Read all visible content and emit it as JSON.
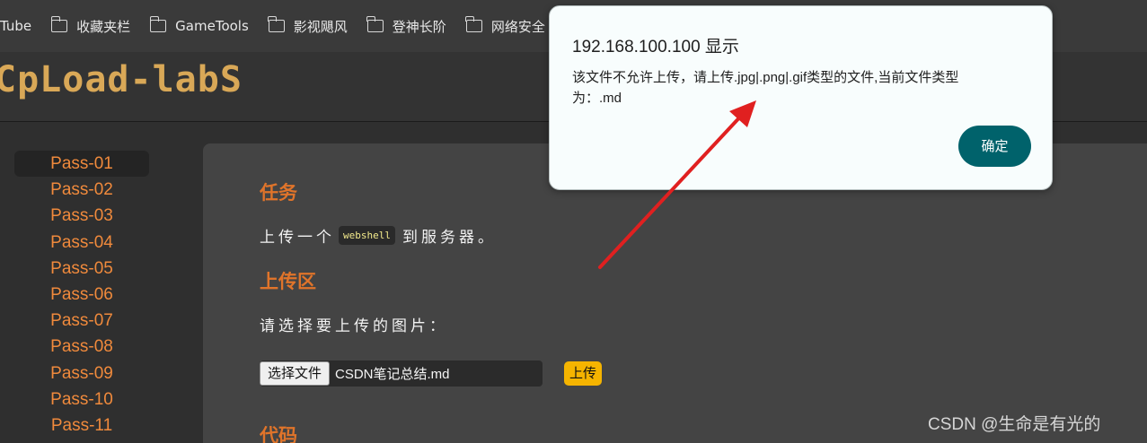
{
  "bookmarks": {
    "items": [
      {
        "label": "Tube",
        "icon": "none"
      },
      {
        "label": "收藏夹栏",
        "icon": "folder-icon"
      },
      {
        "label": "GameTools",
        "icon": "folder-icon"
      },
      {
        "label": "影视飓风",
        "icon": "folder-icon"
      },
      {
        "label": "登神长阶",
        "icon": "folder-icon"
      },
      {
        "label": "网络安全",
        "icon": "folder-icon"
      }
    ]
  },
  "header": {
    "logo_text": "CpLoad-labS"
  },
  "sidebar": {
    "items": [
      {
        "label": "Pass-01",
        "active": true
      },
      {
        "label": "Pass-02"
      },
      {
        "label": "Pass-03"
      },
      {
        "label": "Pass-04"
      },
      {
        "label": "Pass-05"
      },
      {
        "label": "Pass-06"
      },
      {
        "label": "Pass-07"
      },
      {
        "label": "Pass-08"
      },
      {
        "label": "Pass-09"
      },
      {
        "label": "Pass-10"
      },
      {
        "label": "Pass-11"
      }
    ]
  },
  "main": {
    "task_title": "任务",
    "task_prefix": "上传一个",
    "task_code": "webshell",
    "task_suffix": "到服务器。",
    "upload_title": "上传区",
    "upload_prompt": "请选择要上传的图片：",
    "file_button_label": "选择文件",
    "file_name": "CSDN笔记总结.md",
    "upload_button_label": "上传",
    "code_title": "代码"
  },
  "dialog": {
    "title": "192.168.100.100 显示",
    "message": "该文件不允许上传，请上传.jpg|.png|.gif类型的文件,当前文件类型为：.md",
    "ok_label": "确定"
  },
  "watermark": "CSDN @生命是有光的",
  "colors": {
    "accent_orange": "#e0742a",
    "nav_orange": "#f08a3c",
    "ok_button": "#00626b",
    "upload_button": "#f5b400",
    "arrow": "#e02020"
  }
}
